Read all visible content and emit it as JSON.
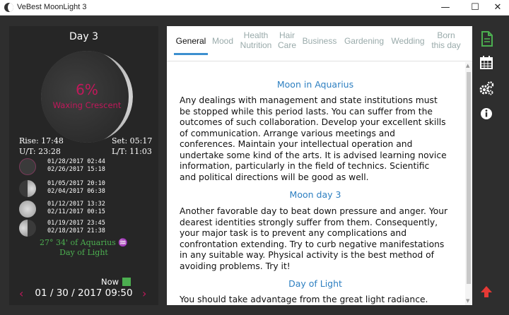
{
  "window": {
    "title": "VeBest MoonLight 3",
    "minimize": "—",
    "maximize": "☐",
    "close": "✕"
  },
  "left_panel": {
    "day_title": "Day 3",
    "illumination": "6%",
    "phase_name": "Waxing Crescent",
    "rise": "Rise: 17:48",
    "set": "Set: 05:17",
    "ut": "U/T: 23:28",
    "lt": "L/T: 11:03",
    "phases": [
      {
        "icon": "new-moon",
        "date1": "01/28/2017 02:44",
        "date2": "02/26/2017 15:18"
      },
      {
        "icon": "first-quarter",
        "date1": "01/05/2017 20:10",
        "date2": "02/04/2017 06:38"
      },
      {
        "icon": "full-moon",
        "date1": "01/12/2017 13:32",
        "date2": "02/11/2017 00:15"
      },
      {
        "icon": "last-quarter",
        "date1": "01/19/2017 23:45",
        "date2": "02/18/2017 21:38"
      }
    ],
    "zodiac": "27° 34' of Aquarius ♒",
    "zodiac_sub": "Day of Light",
    "now_label": "Now",
    "datetime": "01 / 30 / 2017 09:50",
    "prev_arrow": "‹",
    "next_arrow": "›",
    "accent_color": "#c2185b",
    "zodiac_color": "#4caf50"
  },
  "tabs": [
    {
      "line1": "General",
      "line2": ""
    },
    {
      "line1": "Mood",
      "line2": ""
    },
    {
      "line1": "Health",
      "line2": "Nutrition"
    },
    {
      "line1": "Hair",
      "line2": "Care"
    },
    {
      "line1": "Business",
      "line2": ""
    },
    {
      "line1": "Gardening",
      "line2": ""
    },
    {
      "line1": "Wedding",
      "line2": ""
    },
    {
      "line1": "Born",
      "line2": "this day"
    }
  ],
  "active_tab": "General",
  "sections": [
    {
      "heading": "Moon in Aquarius",
      "text": "Any dealings with management and state institutions must be stopped while this period lasts. You can suffer from the outcomes of such collaboration. Develop your excellent skills of communication. Arrange various meetings and conferences. Maintain your intellectual operation and undertake some kind of the arts. It is advised learning novice information, particularly in the field of technics. Scientific and political directions will be good as well."
    },
    {
      "heading": "Moon day 3",
      "text": "Another favorable day to beat down pressure and anger. Your dearest identities strongly suffer from them. Consequently, your major task is to prevent any complications and confrontation extending. Try to curb negative manifestations in any suitable way. Physical activity is the best method of avoiding problems. Try it!"
    },
    {
      "heading": "Day of Light",
      "text": "You should take advantage from the great light radiance."
    }
  ],
  "right_toolbar": [
    {
      "icon": "document-icon",
      "color": "#4caf50"
    },
    {
      "icon": "calendar-icon",
      "color": "#ffffff"
    },
    {
      "icon": "gears-icon",
      "color": "#ffffff"
    },
    {
      "icon": "info-icon",
      "color": "#ffffff"
    },
    {
      "icon": "arrow-up-icon",
      "color": "#e53935"
    }
  ]
}
